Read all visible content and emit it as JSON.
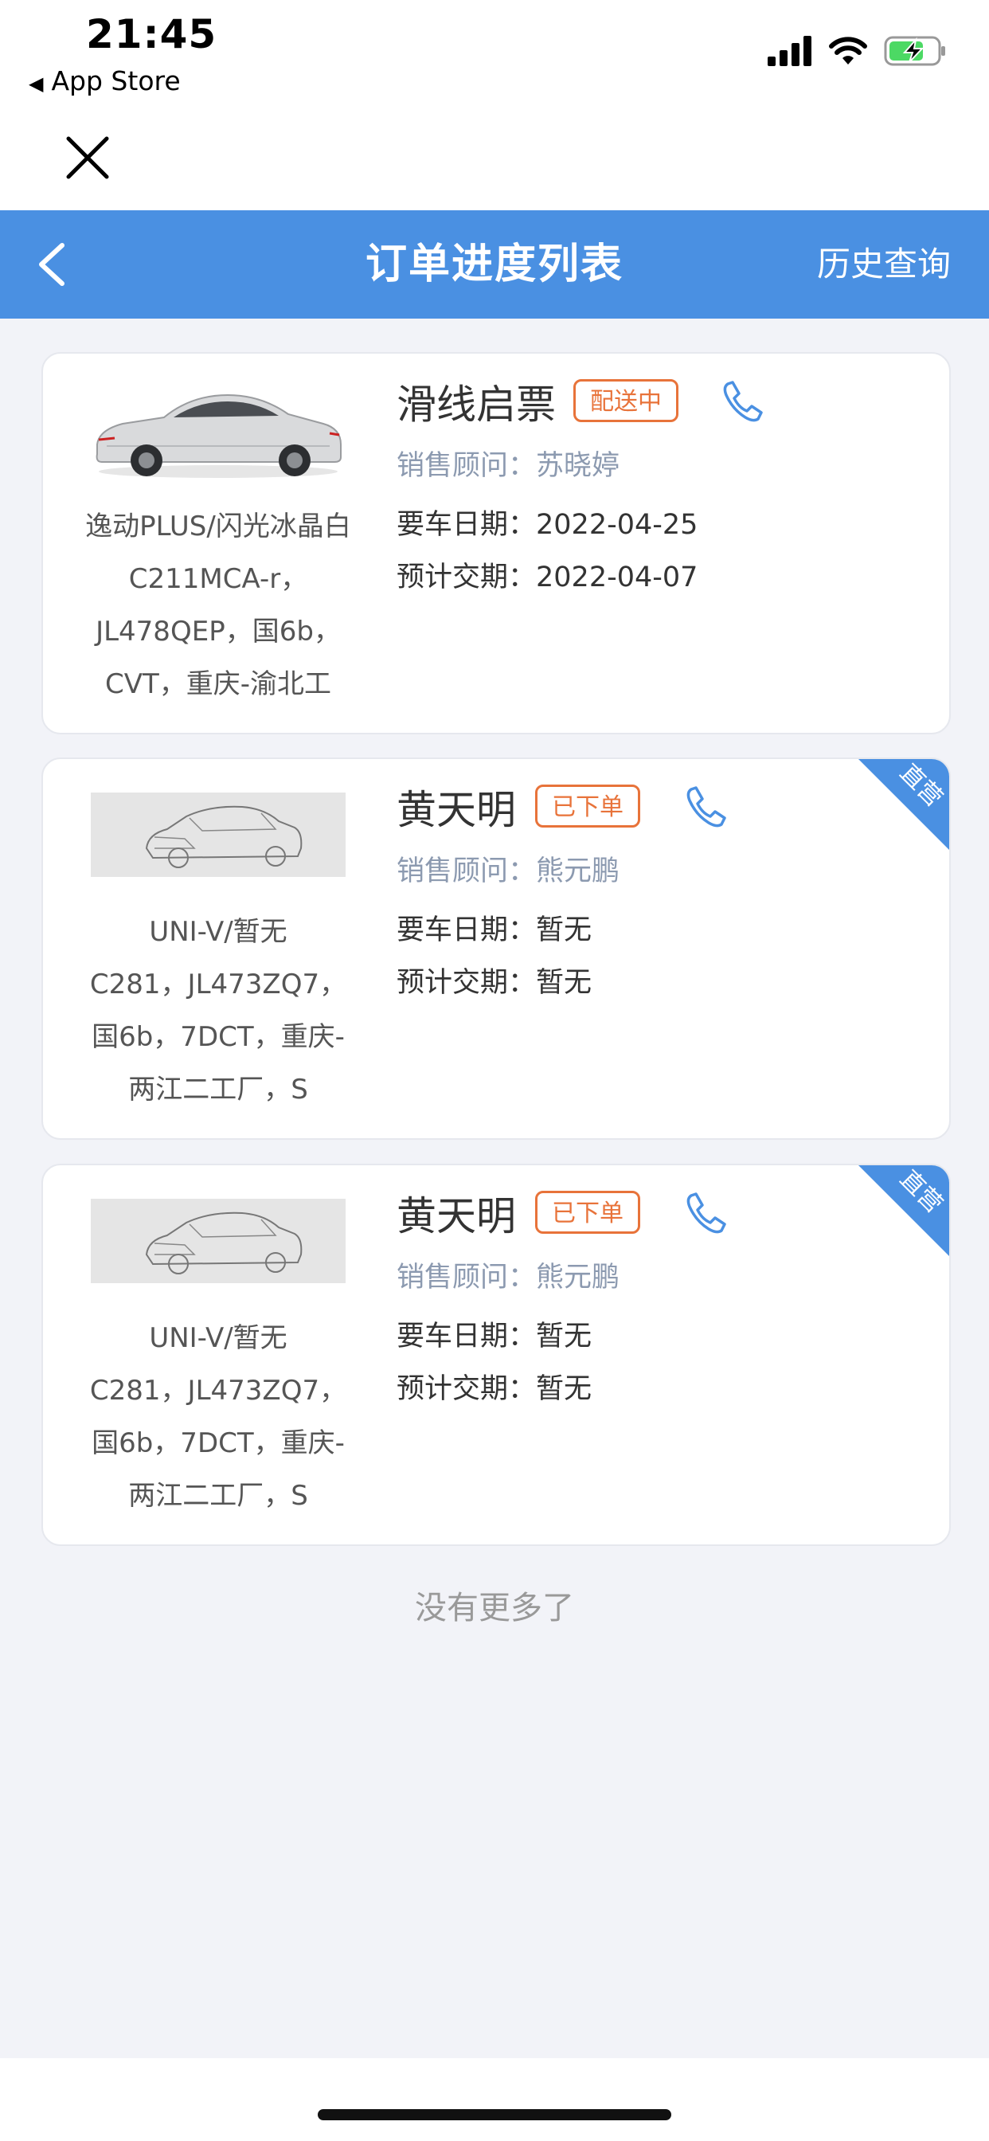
{
  "status_bar": {
    "time": "21:45",
    "back_app": "App Store",
    "back_arrow_icon": "left-triangle-icon",
    "battery_state": "charging"
  },
  "nav": {
    "title": "订单进度列表",
    "history": "历史查询",
    "back_icon": "chevron-left-icon"
  },
  "colors": {
    "primary": "#4a90e2",
    "badge": "#e8733a",
    "consultant": "#8c9ab0",
    "page_bg": "#f2f3f8"
  },
  "labels": {
    "consultant": "销售顾问：",
    "want_date": "要车日期：",
    "eta_date": "预计交期："
  },
  "orders": [
    {
      "customer": "滑线启票",
      "status": "配送中",
      "consultant": "苏晓婷",
      "want_date": "2022-04-25",
      "eta_date": "2022-04-07",
      "car_lines": [
        "逸动PLUS/闪光冰晶白",
        "C211MCA-r，",
        "JL478QEP，国6b，",
        "CVT，重庆-渝北工"
      ],
      "image": "car-photo-white-sedan",
      "corner_tag": ""
    },
    {
      "customer": "黄天明",
      "status": "已下单",
      "consultant": "熊元鹏",
      "want_date": "暂无",
      "eta_date": "暂无",
      "car_lines": [
        "UNI-V/暂无",
        "C281，JL473ZQ7，",
        "国6b，7DCT，重庆-",
        "两江二工厂，S"
      ],
      "image": "car-sketch-placeholder",
      "corner_tag": "直营"
    },
    {
      "customer": "黄天明",
      "status": "已下单",
      "consultant": "熊元鹏",
      "want_date": "暂无",
      "eta_date": "暂无",
      "car_lines": [
        "UNI-V/暂无",
        "C281，JL473ZQ7，",
        "国6b，7DCT，重庆-",
        "两江二工厂，S"
      ],
      "image": "car-sketch-placeholder",
      "corner_tag": "直营"
    }
  ],
  "footer": {
    "no_more": "没有更多了"
  }
}
